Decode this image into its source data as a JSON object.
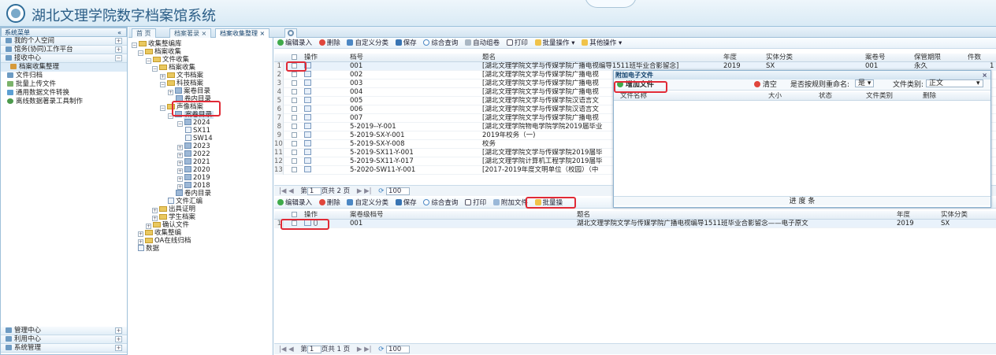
{
  "app": {
    "title": "湖北文理学院数字档案馆系统"
  },
  "left_panel": {
    "title": "系统菜单",
    "collapse": "«",
    "sections": [
      {
        "label": "我的个人空间"
      },
      {
        "label": "馆务(协同)工作平台"
      },
      {
        "label": "接收中心"
      }
    ],
    "items": [
      "档案收集整理",
      "文件归档",
      "批量上传文件",
      "通用数据文件转换",
      "离线数据著录工具制作"
    ],
    "bottom_sections": [
      {
        "label": "管理中心"
      },
      {
        "label": "利用中心"
      },
      {
        "label": "系统管理"
      }
    ]
  },
  "tabs": [
    {
      "label": "首 页"
    },
    {
      "label": "档案著录"
    },
    {
      "label": "档案收集整理"
    }
  ],
  "tree": {
    "root": "收集整编库",
    "n1": "档案收集",
    "n2": "文件收集",
    "n3": "档案收集",
    "n4": "文书档案",
    "n5": "科技档案",
    "n6": "案卷目录",
    "n7": "卷内目录",
    "n8": "声像档案",
    "n9": "案卷目录",
    "y2024": "2024",
    "sx11": "SX11",
    "sw14": "SW14",
    "years": [
      "2023",
      "2022",
      "2021",
      "2020",
      "2019",
      "2018"
    ],
    "n10": "卷内目录",
    "n11": "文件汇编",
    "n12": "出具证明",
    "n13": "学生档案",
    "n14": "确认文件",
    "n15": "收集整编",
    "n16": "OA在线归档",
    "n17": "数据"
  },
  "toolbar": {
    "items": [
      "编辑录入",
      "删除",
      "自定义分类",
      "保存",
      "综合查询",
      "自动组卷",
      "打印",
      "批量操作",
      "其他操作"
    ]
  },
  "grid": {
    "headers": {
      "op": "操作",
      "code": "档号",
      "title": "题名",
      "year": "年度",
      "entity": "实体分类",
      "vol": "案卷号",
      "period": "保管期限",
      "count": "件数"
    },
    "rows": [
      {
        "n": "1",
        "code": "001",
        "title": "[湖北文理学院文学与传媒学院广播电视编导1511班毕业合影留念]",
        "year": "2019",
        "entity": "SX",
        "vol": "001",
        "period": "永久",
        "count": "1"
      },
      {
        "n": "2",
        "code": "002",
        "title": "[湖北文理学院文学与传媒学院广播电视"
      },
      {
        "n": "3",
        "code": "003",
        "title": "[湖北文理学院文学与传媒学院广播电视"
      },
      {
        "n": "4",
        "code": "004",
        "title": "[湖北文理学院文学与传媒学院广播电视"
      },
      {
        "n": "5",
        "code": "005",
        "title": "[湖北文理学院文学与传媒学院汉语言文"
      },
      {
        "n": "6",
        "code": "006",
        "title": "[湖北文理学院文学与传媒学院汉语言文"
      },
      {
        "n": "7",
        "code": "007",
        "title": "[湖北文理学院文学与传媒学院广播电视"
      },
      {
        "n": "8",
        "code": "5-2019--Y-001",
        "title": "[湖北文理学院物电学院学院2019届毕业"
      },
      {
        "n": "9",
        "code": "5-2019-SX-Y-001",
        "title": "2019年校务（一)"
      },
      {
        "n": "10",
        "code": "5-2019-SX-Y-008",
        "title": "校务"
      },
      {
        "n": "11",
        "code": "5-2019-SX11-Y-001",
        "title": "[湖北文理学院文学与传媒学院2019届毕"
      },
      {
        "n": "12",
        "code": "5-2019-SX11-Y-017",
        "title": "[湖北文理学院计算机工程学院2019届毕"
      },
      {
        "n": "13",
        "code": "5-2020-SW11-Y-001",
        "title": "[2017-2019年度文明单位（校园）（中"
      }
    ]
  },
  "pager1": {
    "page_label": "第",
    "page": "1",
    "total": "页共 2 页",
    "size": "100"
  },
  "toolbar2": {
    "items": [
      "编辑录入",
      "删除",
      "自定义分类",
      "保存",
      "综合查询",
      "打印",
      "附加文件",
      "批量操"
    ]
  },
  "grid2": {
    "headers": {
      "op": "操作",
      "code": "案卷级档号",
      "title": "题名",
      "year": "年度",
      "entity": "实体分类"
    },
    "rows": [
      {
        "n": "1",
        "code": "001",
        "title": "湖北文理学院文学与传媒学院广播电视编导1511班毕业合影留念——电子原文",
        "year": "2019",
        "entity": "SX"
      }
    ]
  },
  "pager2": {
    "page_label": "第",
    "page": "1",
    "total": "页共 1 页",
    "size": "100"
  },
  "dialog": {
    "title": "附加电子文件",
    "add": "增加文件",
    "clear": "清空",
    "rename_label": "是否按规则重命名:",
    "rename_value": "是",
    "type_label": "文件类别:",
    "type_value": "正文",
    "headers": [
      "文件名称",
      "大小",
      "状态",
      "文件类别",
      "删除"
    ],
    "progress": "进 度 条"
  },
  "colors": {
    "accent": "#2a5d86",
    "highlight": "#e02a36"
  }
}
